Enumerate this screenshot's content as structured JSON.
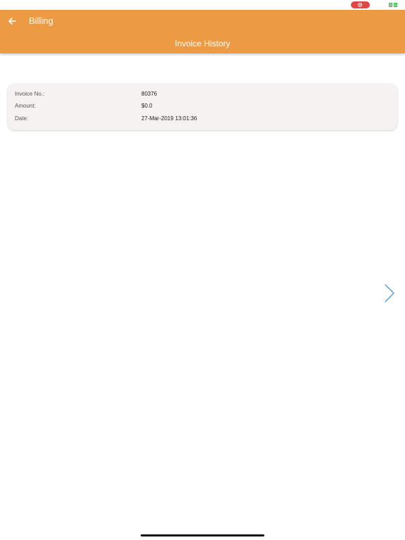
{
  "header": {
    "title": "Billing",
    "subtitle": "Invoice History",
    "accent_color": "#ec9a43"
  },
  "invoice": {
    "rows": [
      {
        "label": "Invoice No.:",
        "value": "80376"
      },
      {
        "label": "Amount:",
        "value": "$0.0"
      },
      {
        "label": "Date:",
        "value": "27-Mar-2019 13:01:36"
      }
    ]
  },
  "icons": {
    "back": "arrow-left-icon",
    "next": "chevron-right-icon",
    "recording": "screen-record-icon",
    "battery": "battery-icon"
  }
}
